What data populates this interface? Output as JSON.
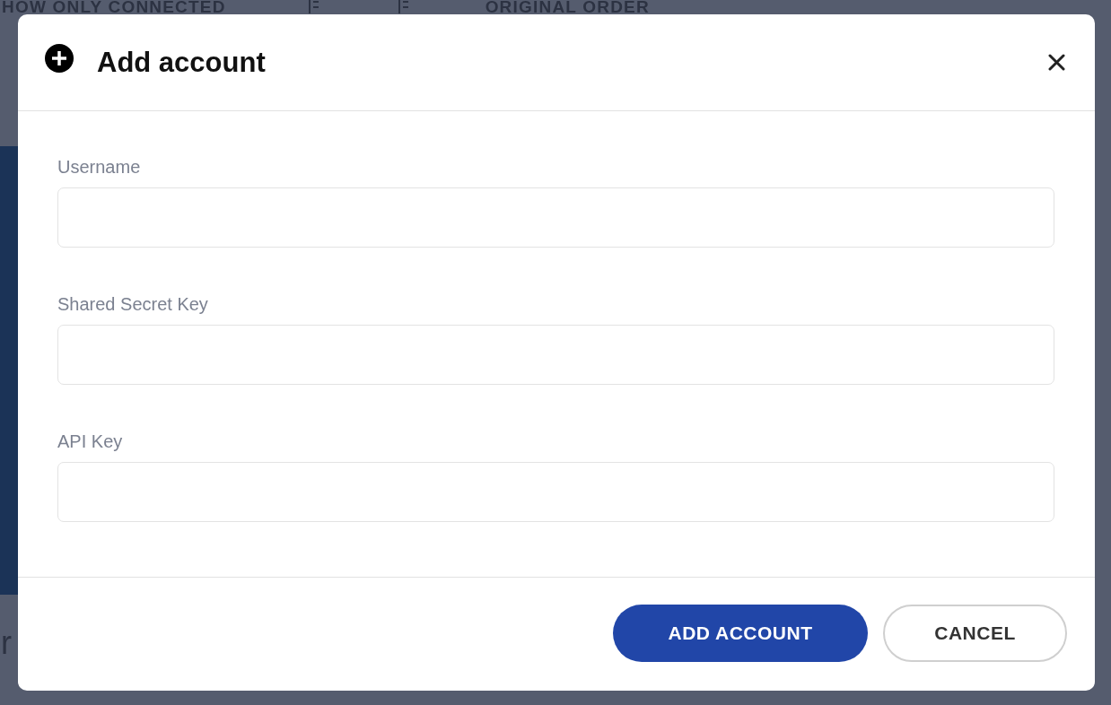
{
  "background": {
    "filter_label": "HOW ONLY CONNECTED",
    "sort_label": "ORIGINAL ORDER",
    "side_text": "r"
  },
  "dialog": {
    "title": "Add account",
    "fields": [
      {
        "label": "Username"
      },
      {
        "label": "Shared Secret Key"
      },
      {
        "label": "API Key"
      }
    ],
    "buttons": [
      {
        "label": "ADD ACCOUNT",
        "kind": "primary"
      },
      {
        "label": "CANCEL",
        "kind": "secondary"
      }
    ]
  }
}
